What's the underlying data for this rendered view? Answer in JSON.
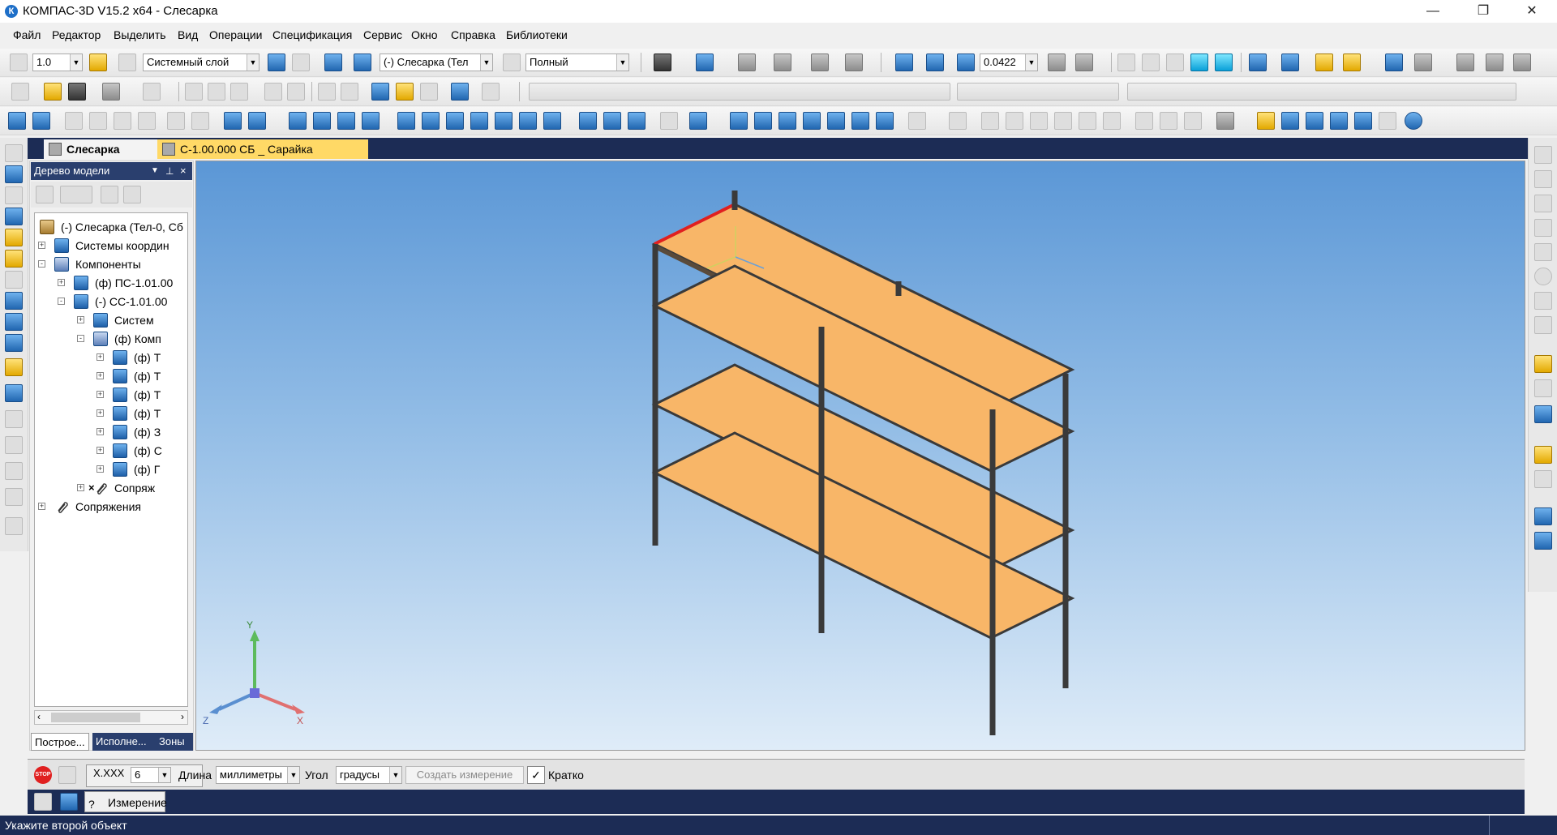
{
  "window": {
    "title": "КОМПАС-3D V15.2  x64 - Слесарка",
    "app_logo": "К"
  },
  "menu": [
    "Файл",
    "Редактор",
    "Выделить",
    "Вид",
    "Операции",
    "Спецификация",
    "Сервис",
    "Окно",
    "Справка",
    "Библиотеки"
  ],
  "toolbar1": {
    "step_value": "1.0",
    "layer": "Системный слой",
    "component": "(-) Слесарка (Тел",
    "display_mode": "Полный",
    "scale": "0.0422"
  },
  "doc_tabs": [
    {
      "label": "Слесарка",
      "active": true
    },
    {
      "label": "С-1.00.000 СБ _ Сарайка",
      "active": false
    }
  ],
  "model_tree": {
    "header": "Дерево модели",
    "rows": [
      {
        "label": "(-) Слесарка (Тел-0, Сб",
        "indent": 0,
        "expander": "",
        "icon": "root"
      },
      {
        "label": "Системы координ",
        "indent": 1,
        "expander": "+",
        "icon": "coord"
      },
      {
        "label": "Компоненты",
        "indent": 1,
        "expander": "-",
        "icon": "components"
      },
      {
        "label": "(ф) ПС-1.01.00",
        "indent": 2,
        "expander": "+",
        "icon": "part"
      },
      {
        "label": "(-) СС-1.01.00",
        "indent": 2,
        "expander": "-",
        "icon": "part"
      },
      {
        "label": "Систем",
        "indent": 3,
        "expander": "+",
        "icon": "coord"
      },
      {
        "label": "(ф) Комп",
        "indent": 3,
        "expander": "-",
        "icon": "components"
      },
      {
        "label": "(ф) Т",
        "indent": 4,
        "expander": "+",
        "icon": "part"
      },
      {
        "label": "(ф) Т",
        "indent": 4,
        "expander": "+",
        "icon": "part"
      },
      {
        "label": "(ф) Т",
        "indent": 4,
        "expander": "+",
        "icon": "part"
      },
      {
        "label": "(ф) Т",
        "indent": 4,
        "expander": "+",
        "icon": "part"
      },
      {
        "label": "(ф) З",
        "indent": 4,
        "expander": "+",
        "icon": "part"
      },
      {
        "label": "(ф) С",
        "indent": 4,
        "expander": "+",
        "icon": "part"
      },
      {
        "label": "(ф) Г",
        "indent": 4,
        "expander": "+",
        "icon": "part"
      },
      {
        "label": "Сопряж",
        "indent": 3,
        "expander": "+",
        "icon": "mate",
        "mark": "×"
      },
      {
        "label": "Сопряжения",
        "indent": 1,
        "expander": "+",
        "icon": "mate"
      }
    ],
    "panel_tabs": [
      "Построе...",
      "Исполне...",
      "Зоны"
    ]
  },
  "viewport": {
    "axis_labels": {
      "x": "X",
      "y": "Y",
      "z": "Z"
    }
  },
  "command_panel": {
    "precision_label": "X.XXX",
    "precision_value": "6",
    "length_label": "Длина",
    "length_unit": "миллиметры",
    "angle_label": "Угол",
    "angle_unit": "градусы",
    "create_button": "Создать измерение",
    "brief_check": "✓",
    "brief_label": "Кратко",
    "stop_label": "STOP",
    "measure_tab": "Измерение"
  },
  "status": {
    "text": "Укажите второй объект"
  },
  "colors": {
    "accent_dark": "#1c2c55",
    "shelf": "#f8b668",
    "frame": "#4a4a4a",
    "highlight": "#e02020"
  }
}
